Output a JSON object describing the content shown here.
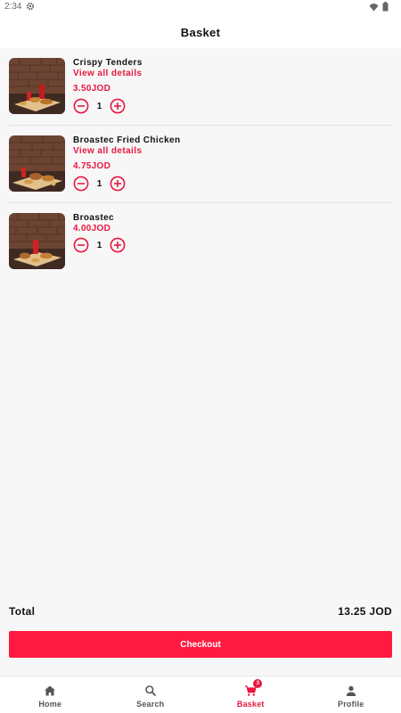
{
  "status_bar": {
    "time": "2:34"
  },
  "header": {
    "title": "Basket"
  },
  "items": [
    {
      "name": "Crispy Tenders",
      "details_link": "View all details",
      "price": "3.50JOD",
      "quantity": "1"
    },
    {
      "name": "Broastec Fried Chicken",
      "details_link": "View all details",
      "price": "4.75JOD",
      "quantity": "1"
    },
    {
      "name": "Broastec",
      "price": "4.00JOD",
      "quantity": "1"
    }
  ],
  "summary": {
    "total_label": "Total",
    "total_value": "13.25 JOD"
  },
  "checkout": {
    "label": "Checkout"
  },
  "nav": {
    "home": "Home",
    "search": "Search",
    "basket": "Basket",
    "basket_badge": "3",
    "profile": "Profile"
  },
  "colors": {
    "accent": "#e8173f",
    "button": "#ff1a41"
  },
  "icons": {
    "status": [
      "gear-icon",
      "wifi-icon",
      "battery-icon"
    ],
    "quantity": [
      "minus-circle-icon",
      "plus-circle-icon"
    ],
    "nav": [
      "home-icon",
      "search-icon",
      "cart-icon",
      "person-icon"
    ]
  }
}
